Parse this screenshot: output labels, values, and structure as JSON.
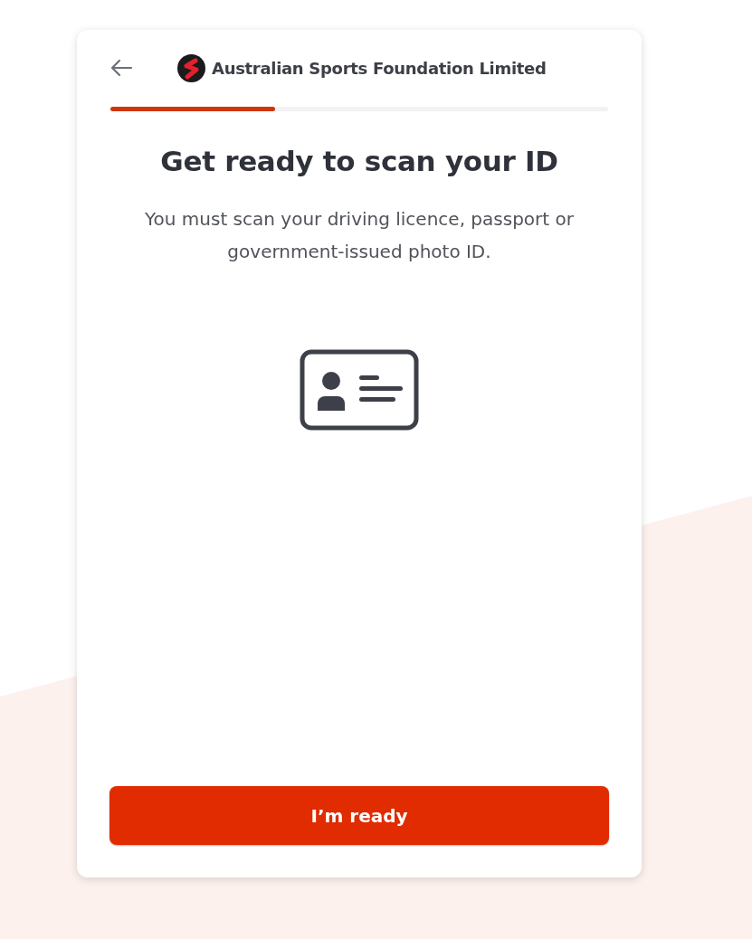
{
  "header": {
    "brand": "Australian Sports Foundation Limited"
  },
  "progress": {
    "level": 0.33
  },
  "title": "Get ready to scan your ID",
  "description": "You must scan your driving licence, passport or government-issued photo ID.",
  "button": {
    "label": "I’m ready"
  }
}
